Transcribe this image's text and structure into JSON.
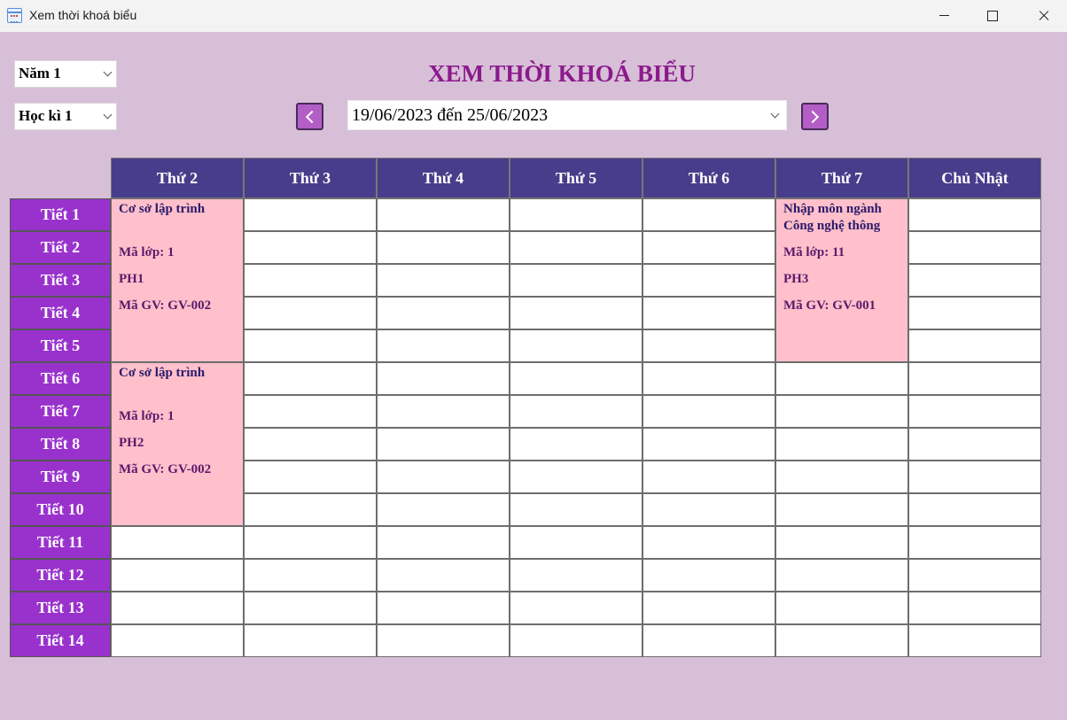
{
  "window": {
    "title": "Xem thời khoá biểu",
    "icon": "calendar-icon"
  },
  "filters": {
    "year": "Năm 1",
    "semester": "Học kì 1",
    "week": "19/06/2023 đến 25/06/2023"
  },
  "title": "XEM THỜI KHOÁ BIỂU",
  "colors": {
    "header": "#483d8b",
    "period": "#9932cc",
    "course": "#ffc0cb",
    "title": "#8b1a8b",
    "background": "#d8bfd8"
  },
  "timetable": {
    "days": [
      "Thứ 2",
      "Thứ 3",
      "Thứ 4",
      "Thứ 5",
      "Thứ 6",
      "Thứ 7",
      "Chủ Nhật"
    ],
    "periods": [
      "Tiết 1",
      "Tiết 2",
      "Tiết 3",
      "Tiết 4",
      "Tiết 5",
      "Tiết 6",
      "Tiết 7",
      "Tiết 8",
      "Tiết 9",
      "Tiết 10",
      "Tiết 11",
      "Tiết 12",
      "Tiết 13",
      "Tiết 14"
    ],
    "courses": [
      {
        "day": 1,
        "start": 1,
        "end": 5,
        "name": "Cơ sở lập trình",
        "class": "Mã lớp: 1",
        "room": "PH1",
        "teacher": "Mã GV: GV-002"
      },
      {
        "day": 1,
        "start": 6,
        "end": 10,
        "name": "Cơ sở lập trình",
        "class": "Mã lớp: 1",
        "room": "PH2",
        "teacher": "Mã GV: GV-002"
      },
      {
        "day": 6,
        "start": 1,
        "end": 5,
        "name": "Nhập môn ngành Công nghệ thông",
        "class": "Mã lớp: 11",
        "room": "PH3",
        "teacher": "Mã GV: GV-001"
      }
    ]
  }
}
